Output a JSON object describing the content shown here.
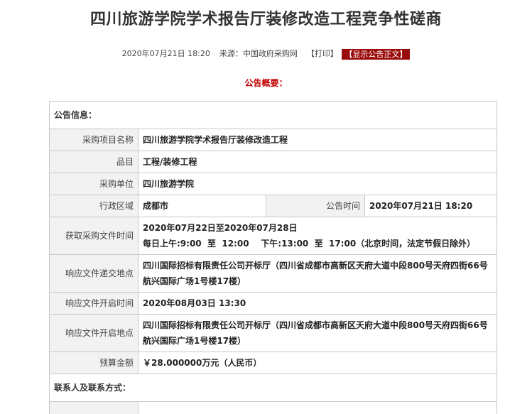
{
  "title": "四川旅游学院学术报告厅装修改造工程竞争性磋商",
  "meta": {
    "datetime": "2020年07月21日  18:20",
    "source_label": "来源：",
    "source": "中国政府采购网",
    "print_label": "【打印】",
    "show_label": "【显示公告正文】"
  },
  "summary_heading": "公告概要：",
  "sections": {
    "info_title": "公告信息：",
    "contact_title": "联系人及联系方式："
  },
  "rows": {
    "project_name": {
      "label": "采购项目名称",
      "value": "四川旅游学院学术报告厅装修改造工程"
    },
    "category": {
      "label": "品目",
      "value": "工程/装修工程"
    },
    "purchaser": {
      "label": "采购单位",
      "value": "四川旅游学院"
    },
    "region": {
      "label": "行政区域",
      "value": "成都市"
    },
    "announce_time": {
      "label": "公告时间",
      "value": "2020年07月21日  18:20"
    },
    "obtain_time": {
      "label": "获取采购文件时间",
      "line1": "2020年07月22日至2020年07月28日",
      "line2": "每日上午:9:00  至  12:00    下午:13:00  至  17:00（北京时间，法定节假日除外）"
    },
    "submit_place": {
      "label": "响应文件递交地点",
      "value": "四川国际招标有限责任公司开标厅（四川省成都市高新区天府大道中段800号天府四街66号航兴国际广场1号楼17楼）"
    },
    "open_time": {
      "label": "响应文件开启时间",
      "value": "2020年08月03日  13:30"
    },
    "open_place": {
      "label": "响应文件开启地点",
      "value": "四川国际招标有限责任公司开标厅（四川省成都市高新区天府大道中段800号天府四街66号航兴国际广场1号楼17楼）"
    },
    "budget": {
      "label": "预算金额",
      "value": "￥28.000000万元（人民币）"
    }
  }
}
